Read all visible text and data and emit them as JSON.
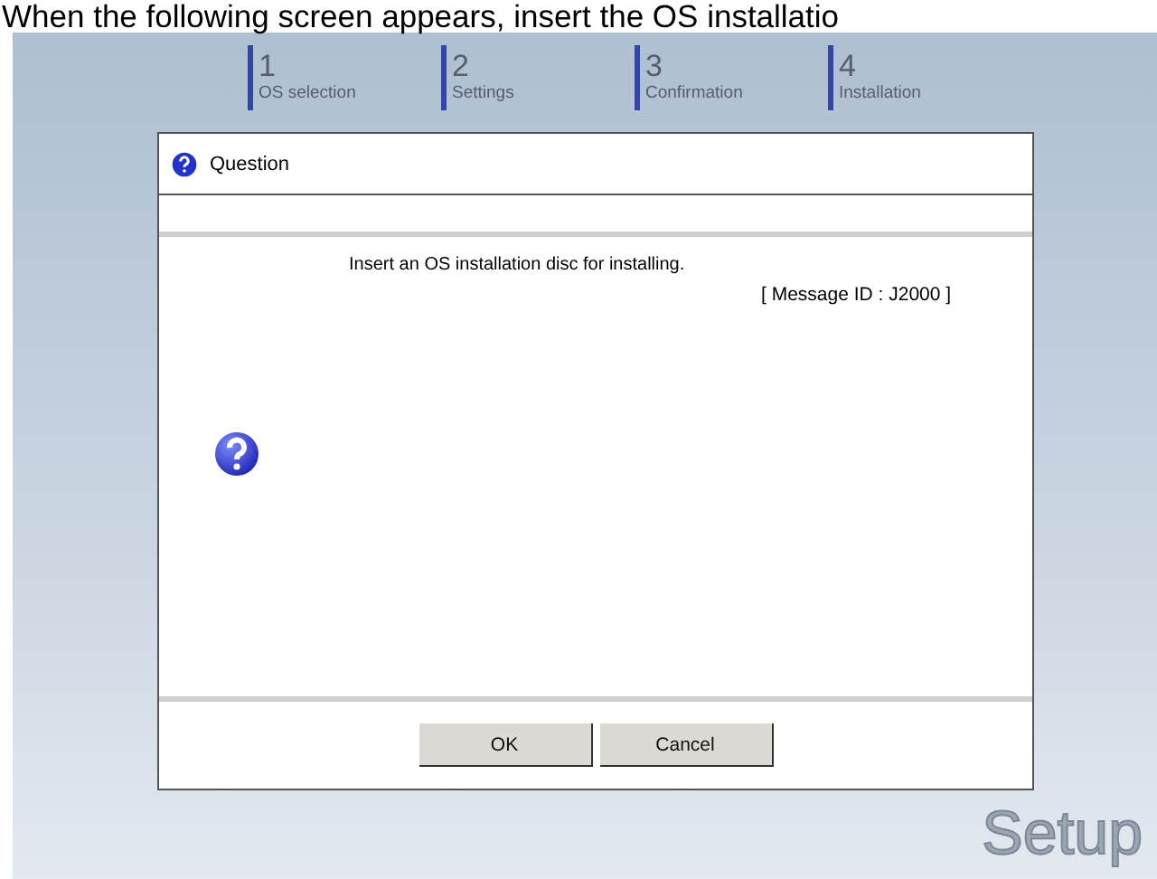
{
  "caption": "When the following screen appears, insert the OS installatio",
  "steps": [
    {
      "number": "1",
      "label": "OS selection"
    },
    {
      "number": "2",
      "label": "Settings"
    },
    {
      "number": "3",
      "label": "Confirmation"
    },
    {
      "number": "4",
      "label": "Installation"
    }
  ],
  "dialog": {
    "title": "Question",
    "message": "Insert an OS installation disc for installing.",
    "message_id": "[ Message ID : J2000 ]",
    "buttons": [
      "OK",
      "Cancel"
    ]
  },
  "brand": "Setup"
}
